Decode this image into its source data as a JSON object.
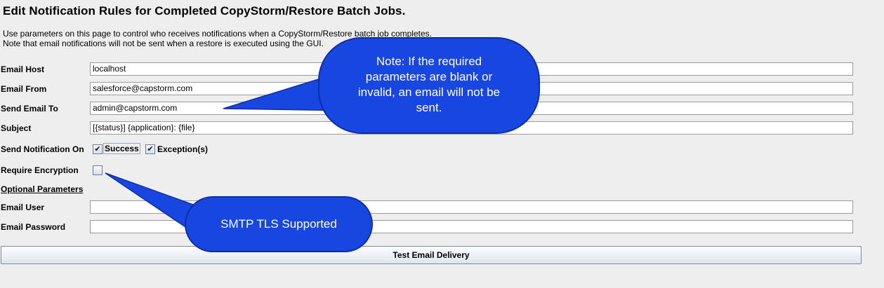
{
  "page": {
    "title": "Edit Notification Rules for Completed CopyStorm/Restore Batch Jobs.",
    "description_line1": "Use parameters on this page to control who receives notifications when a CopyStorm/Restore batch job completes.",
    "description_line2": "Note that email notifications will not be sent when a restore is executed using the GUI."
  },
  "form": {
    "email_host": {
      "label": "Email Host",
      "value": "localhost"
    },
    "email_from": {
      "label": "Email From",
      "value": "salesforce@capstorm.com"
    },
    "send_email_to": {
      "label": "Send Email To",
      "value": "admin@capstorm.com"
    },
    "subject": {
      "label": "Subject",
      "value": "[{status}] {application}: {file}"
    },
    "send_notification_on": {
      "label": "Send Notification On",
      "success": {
        "label": "Success",
        "checked": true
      },
      "exceptions": {
        "label": "Exception(s)",
        "checked": true
      }
    },
    "require_encryption": {
      "label": "Require Encryption",
      "checked": false
    },
    "optional_parameters": {
      "label": "Optional Parameters"
    },
    "email_user": {
      "label": "Email User",
      "value": ""
    },
    "email_password": {
      "label": "Email Password",
      "value": ""
    },
    "test_button": {
      "label": "Test Email Delivery"
    }
  },
  "callouts": {
    "note": {
      "line1": "Note: If the required",
      "line2": "parameters are blank or",
      "line3": "invalid, an email will not be",
      "line4": "sent."
    },
    "smtp": {
      "text": "SMTP TLS Supported"
    },
    "color": "#1846e0"
  },
  "icons": {
    "check": "check-icon"
  }
}
